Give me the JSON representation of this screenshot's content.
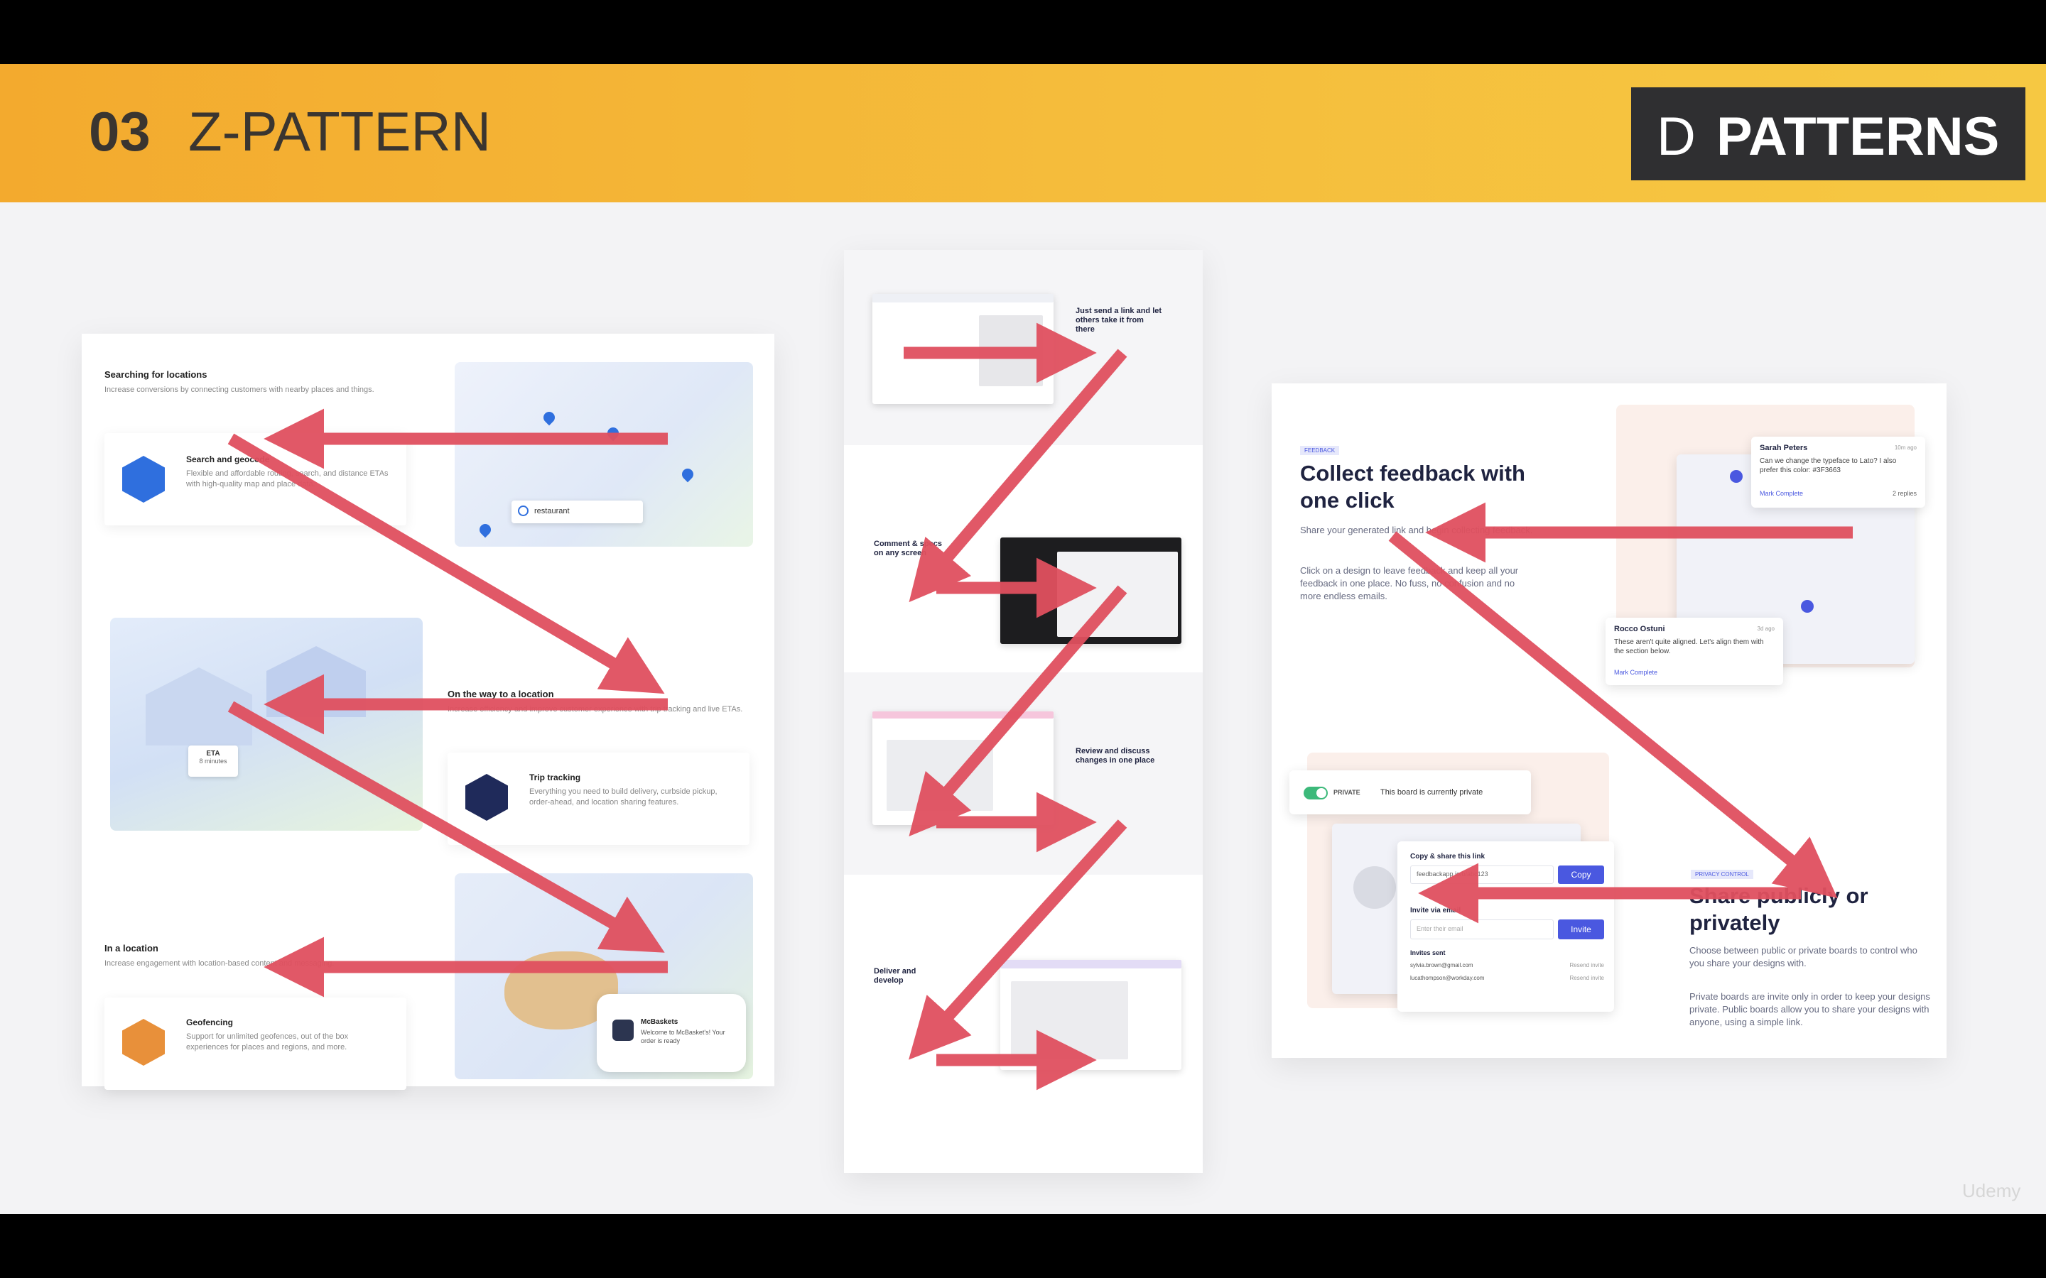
{
  "header": {
    "number": "03",
    "title": "Z-PATTERN"
  },
  "logo": {
    "letter": "D",
    "text": "PATTERNS"
  },
  "left_card": {
    "s1_title": "Searching for locations",
    "s1_desc": "Increase conversions by connecting customers with nearby places and things.",
    "f1_title": "Search and geocode",
    "f1_desc": "Flexible and affordable routing, search, and distance ETAs with high-quality map and place data.",
    "search_value": "restaurant",
    "s2_title": "On the way to a location",
    "s2_desc": "Increase efficiency and improve customer experience with trip tracking and live ETAs.",
    "f2_title": "Trip tracking",
    "f2_desc": "Everything you need to build delivery, curbside pickup, order-ahead, and location sharing features.",
    "eta_label": "ETA",
    "eta_value": "8 minutes",
    "s3_title": "In a location",
    "s3_desc": "Increase engagement with location-based content and messaging.",
    "f3_title": "Geofencing",
    "f3_desc": "Support for unlimited geofences, out of the box experiences for places and regions, and more.",
    "notif_title": "McBaskets",
    "notif_text": "Welcome to McBasket's! Your order is ready"
  },
  "middle_card": {
    "step1": "Just send a link and let others take it from there",
    "step2": "Comment & specs on any screen",
    "step3": "Review and discuss changes in one place",
    "step4": "Deliver and develop"
  },
  "right_card": {
    "tag1": "FEEDBACK",
    "title1": "Collect feedback with one click",
    "desc1a": "Share your generated link and begin collecting feedback.",
    "desc1b": "Click on a design to leave feedback and keep all your feedback in one place. No fuss, no confusion and no more endless emails.",
    "comment1_author": "Sarah Peters",
    "comment1_time": "10m ago",
    "comment1_text": "Can we change the typeface to Lato? I also prefer this color: #3F3663",
    "comment1_action": "Mark Complete",
    "comment1_replies": "2 replies",
    "comment2_author": "Rocco Ostuni",
    "comment2_time": "3d ago",
    "comment2_text": "These aren't quite aligned. Let's align them with the section below.",
    "comment2_action": "Mark Complete",
    "toggle_label": "PRIVATE",
    "board_text": "This board is currently private",
    "share_title": "Copy & share this link",
    "share_url": "feedbackapp.io/b/abc123",
    "copy_btn": "Copy",
    "invite_title": "Invite via email",
    "invite_placeholder": "Enter their email",
    "invite_btn": "Invite",
    "invited_label": "Invites sent",
    "invited1": "sylvia.brown@gmail.com",
    "invited2": "lucathompson@workday.com",
    "invited_status": "Resend invite",
    "tag2": "PRIVACY CONTROL",
    "title2": "Share publicly or privately",
    "desc2a": "Choose between public or private boards to control who you share your designs with.",
    "desc2b": "Private boards are invite only in order to keep your designs private. Public boards allow you to share your designs with anyone, using a simple link."
  },
  "watermark": "Udemy",
  "colors": {
    "banner": "#f5bd3c",
    "arrow": "#e0505f",
    "logo_bg": "#2f2f31",
    "accent_blue": "#4a58e0"
  }
}
